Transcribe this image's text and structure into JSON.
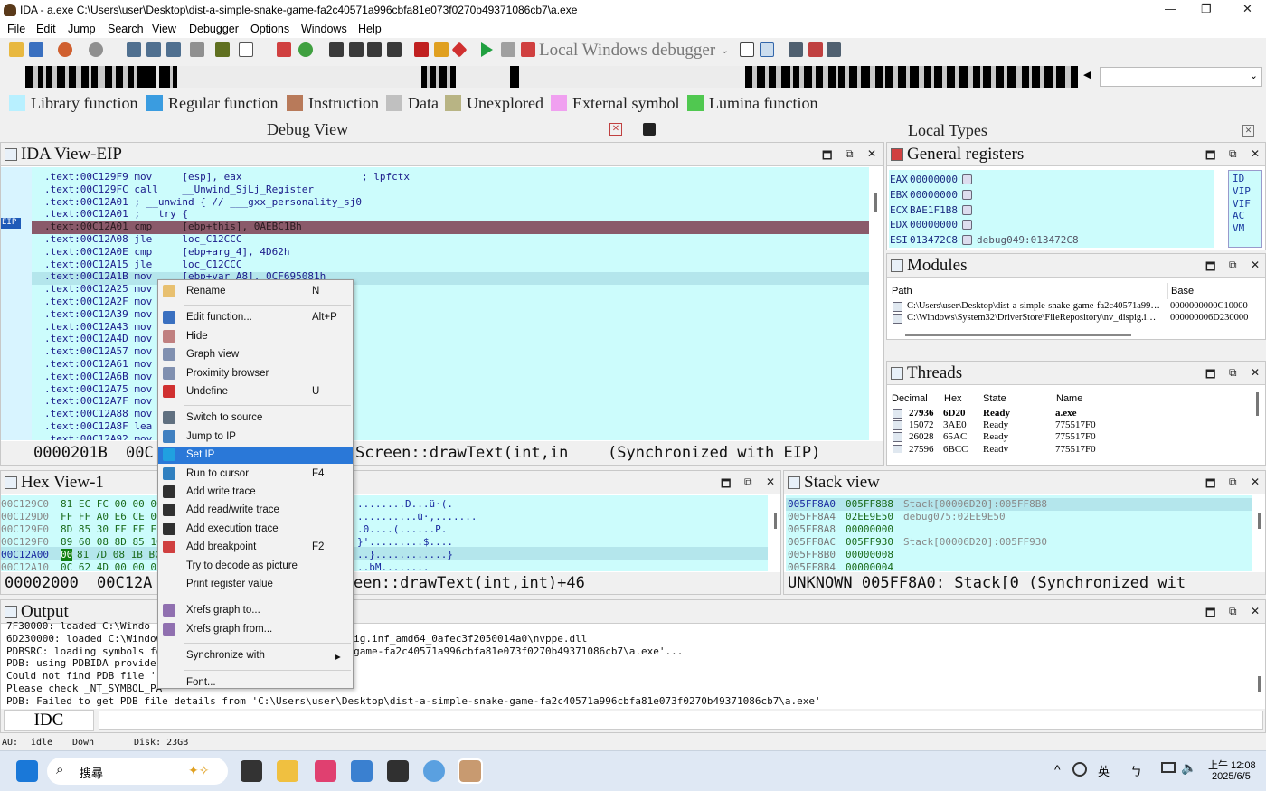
{
  "window": {
    "title": "IDA - a.exe C:\\Users\\user\\Desktop\\dist-a-simple-snake-game-fa2c40571a996cbfa81e073f0270b49371086cb7\\a.exe",
    "minimize": "—",
    "maximize": "❐",
    "close": "✕"
  },
  "menu": [
    "File",
    "Edit",
    "Jump",
    "Search",
    "View",
    "Debugger",
    "Options",
    "Windows",
    "Help"
  ],
  "toolbar": {
    "debugger_select": "Local Windows debugger"
  },
  "legend": [
    {
      "label": "Library function",
      "color": "#b8f0ff"
    },
    {
      "label": "Regular function",
      "color": "#3a9ce0"
    },
    {
      "label": "Instruction",
      "color": "#b87a5a"
    },
    {
      "label": "Data",
      "color": "#c0c0c0"
    },
    {
      "label": "Unexplored",
      "color": "#b8b484"
    },
    {
      "label": "External symbol",
      "color": "#f0a0f0"
    },
    {
      "label": "Lumina function",
      "color": "#50c850"
    }
  ],
  "tabs": {
    "debug_view": "Debug View",
    "local_types": "Local Types"
  },
  "ida_view": {
    "title": "IDA View-EIP",
    "eip_label": "EIP",
    "lines": [
      ".text:00C129F9 mov     [esp], eax                    ; lpfctx",
      ".text:00C129FC call    __Unwind_SjLj_Register",
      ".text:00C12A01 ; __unwind { // ___gxx_personality_sj0",
      ".text:00C12A01 ;   try {",
      ".text:00C12A01 cmp     [ebp+this], 0AEBC1Bh",
      ".text:00C12A08 jle     loc_C12CCC",
      ".text:00C12A0E cmp     [ebp+arg_4], 4D62h",
      ".text:00C12A15 jle     loc_C12CCC",
      ".text:00C12A1B mov     [ebp+var_A8], 0CF695081h",
      ".text:00C12A25 mov",
      ".text:00C12A2F mov",
      ".text:00C12A39 mov",
      ".text:00C12A43 mov",
      ".text:00C12A4D mov",
      ".text:00C12A57 mov",
      ".text:00C12A61 mov",
      ".text:00C12A6B mov",
      ".text:00C12A75 mov",
      ".text:00C12A7F mov",
      ".text:00C12A88 mov",
      ".text:00C12A8F lea",
      ".text:00C12A92 mov"
    ],
    "status": {
      "offset": "0000201B",
      "addr": "00C",
      "func": "Screen::drawText(int,in",
      "sync": "(Synchronized with EIP)"
    }
  },
  "general_registers": {
    "title": "General registers",
    "regs": [
      {
        "name": "EAX",
        "value": "00000000",
        "note": ""
      },
      {
        "name": "EBX",
        "value": "00000000",
        "note": ""
      },
      {
        "name": "ECX",
        "value": "BAE1F1B8",
        "note": ""
      },
      {
        "name": "EDX",
        "value": "00000000",
        "note": ""
      },
      {
        "name": "ESI",
        "value": "013472C8",
        "note": "debug049:013472C8"
      }
    ],
    "flags": [
      "ID",
      "VIP",
      "VIF",
      "AC",
      "VM"
    ]
  },
  "modules": {
    "title": "Modules",
    "headers": [
      "Path",
      "Base"
    ],
    "rows": [
      {
        "path": "C:\\Users\\user\\Desktop\\dist-a-simple-snake-game-fa2c40571a99…",
        "base": "0000000000C10000"
      },
      {
        "path": "C:\\Windows\\System32\\DriverStore\\FileRepository\\nv_dispig.i…",
        "base": "000000006D230000"
      }
    ]
  },
  "threads": {
    "title": "Threads",
    "headers": [
      "Decimal",
      "Hex",
      "State",
      "Name"
    ],
    "rows": [
      {
        "dec": "27936",
        "hex": "6D20",
        "state": "Ready",
        "name": "a.exe"
      },
      {
        "dec": "15072",
        "hex": "3AE0",
        "state": "Ready",
        "name": "775517F0"
      },
      {
        "dec": "26028",
        "hex": "65AC",
        "state": "Ready",
        "name": "775517F0"
      },
      {
        "dec": "27596",
        "hex": "6BCC",
        "state": "Ready",
        "name": "775517F0"
      }
    ]
  },
  "hex_view": {
    "title": "Hex View-1",
    "rows": [
      {
        "addr": "00C129C0",
        "bytes": "81 EC FC 00 00 00",
        "ascii": "........D...ü·(."
      },
      {
        "addr": "00C129D0",
        "bytes": "FF FF A0 E6 CE 06",
        "ascii": "..........ü·,......."
      },
      {
        "addr": "00C129E0",
        "bytes": "8D 85 30 FF FF FF",
        "ascii": ".0....(......P."
      },
      {
        "addr": "00C129F0",
        "bytes": "89 60 08 8D 85 10",
        "ascii": "}'.........$...."
      },
      {
        "addr": "00C12A00",
        "bytes": "81 7D 08 1B BC",
        "hl": "00",
        "ascii": "..}............}"
      },
      {
        "addr": "00C12A10",
        "bytes": "0C 62 4D 00 00 0F",
        "ascii": "..bM........"
      }
    ],
    "status": {
      "offset": "00002000",
      "addr": "00C12A",
      "func": "een::drawText(int,int)+46"
    }
  },
  "stack_view": {
    "title": "Stack view",
    "rows": [
      {
        "addr": "005FF8A0",
        "value": "005FF8B8",
        "note": "Stack[00006D20]:005FF8B8"
      },
      {
        "addr": "005FF8A4",
        "value": "02EE9E50",
        "note": "debug075:02EE9E50"
      },
      {
        "addr": "005FF8A8",
        "value": "00000000",
        "note": ""
      },
      {
        "addr": "005FF8AC",
        "value": "005FF930",
        "note": "Stack[00006D20]:005FF930"
      },
      {
        "addr": "005FF8B0",
        "value": "00000008",
        "note": ""
      },
      {
        "addr": "005FF8B4",
        "value": "00000004",
        "note": ""
      }
    ],
    "status": "UNKNOWN 005FF8A0: Stack[0 (Synchronized wit"
  },
  "output": {
    "title": "Output",
    "lines": [
      "7F30000: loaded C:\\Windo",
      "6D230000: loaded C:\\Window                    tory\\nv_dispig.inf_amd64_0afec3f2050014a0\\nvppe.dll",
      "PDBSRC: loading symbols fo                    imple-snake-game-fa2c40571a996cbfa81e073f0270b49371086cb7\\a.exe'...",
      "PDB: using PDBIDA provider",
      "Could not find PDB file ''",
      "Please check _NT_SYMBOL_PA",
      "PDB: Failed to get PDB file details from 'C:\\Users\\user\\Desktop\\dist-a-simple-snake-game-fa2c40571a996cbfa81e073f0270b49371086cb7\\a.exe'"
    ],
    "idc_label": "IDC"
  },
  "statusbar": {
    "au": "AU:",
    "state": "idle",
    "dir": "Down",
    "disk": "Disk: 23GB"
  },
  "context_menu": [
    {
      "label": "Rename",
      "shortcut": "N",
      "icon_color": "#e8c070",
      "icon": "rename-icon"
    },
    {
      "sep": true
    },
    {
      "label": "Edit function...",
      "shortcut": "Alt+P",
      "icon_color": "#3a70c0",
      "icon": "edit-function-icon"
    },
    {
      "label": "Hide",
      "shortcut": "",
      "icon_color": "#c08080",
      "icon": "hide-icon"
    },
    {
      "label": "Graph view",
      "shortcut": "",
      "icon_color": "#8090b0",
      "icon": "graph-view-icon"
    },
    {
      "label": "Proximity browser",
      "shortcut": "",
      "icon_color": "#8090b0",
      "icon": "proximity-icon"
    },
    {
      "label": "Undefine",
      "shortcut": "U",
      "icon_color": "#d03030",
      "icon": "undefine-icon"
    },
    {
      "sep": true
    },
    {
      "label": "Switch to source",
      "shortcut": "",
      "icon_color": "#607080",
      "icon": "source-icon"
    },
    {
      "label": "Jump to IP",
      "shortcut": "",
      "icon_color": "#4080c0",
      "icon": "jump-ip-icon"
    },
    {
      "label": "Set IP",
      "shortcut": "",
      "icon_color": "#20a0e0",
      "icon": "set-ip-icon",
      "active": true
    },
    {
      "label": "Run to cursor",
      "shortcut": "F4",
      "icon_color": "#3080c0",
      "icon": "run-cursor-icon"
    },
    {
      "label": "Add write trace",
      "shortcut": "",
      "icon_color": "#303030",
      "icon": "write-trace-icon"
    },
    {
      "label": "Add read/write trace",
      "shortcut": "",
      "icon_color": "#303030",
      "icon": "rw-trace-icon"
    },
    {
      "label": "Add execution trace",
      "shortcut": "",
      "icon_color": "#303030",
      "icon": "exec-trace-icon"
    },
    {
      "label": "Add breakpoint",
      "shortcut": "F2",
      "icon_color": "#d04040",
      "icon": "breakpoint-icon"
    },
    {
      "label": "Try to decode as picture",
      "shortcut": "",
      "icon_color": "",
      "icon": ""
    },
    {
      "label": "Print register value",
      "shortcut": "",
      "icon_color": "",
      "icon": ""
    },
    {
      "sep": true
    },
    {
      "label": "Xrefs graph to...",
      "shortcut": "",
      "icon_color": "#9070b0",
      "icon": "xrefs-to-icon"
    },
    {
      "label": "Xrefs graph from...",
      "shortcut": "",
      "icon_color": "#9070b0",
      "icon": "xrefs-from-icon"
    },
    {
      "sep": true
    },
    {
      "label": "Synchronize with",
      "shortcut": "▸",
      "icon_color": "",
      "icon": ""
    },
    {
      "sep": true
    },
    {
      "label": "Font...",
      "shortcut": "",
      "icon_color": "",
      "icon": ""
    }
  ],
  "taskbar": {
    "search": "搜尋",
    "ime1": "英",
    "ime2": "ㄅ",
    "time": "上午 12:08",
    "date": "2025/6/5"
  }
}
